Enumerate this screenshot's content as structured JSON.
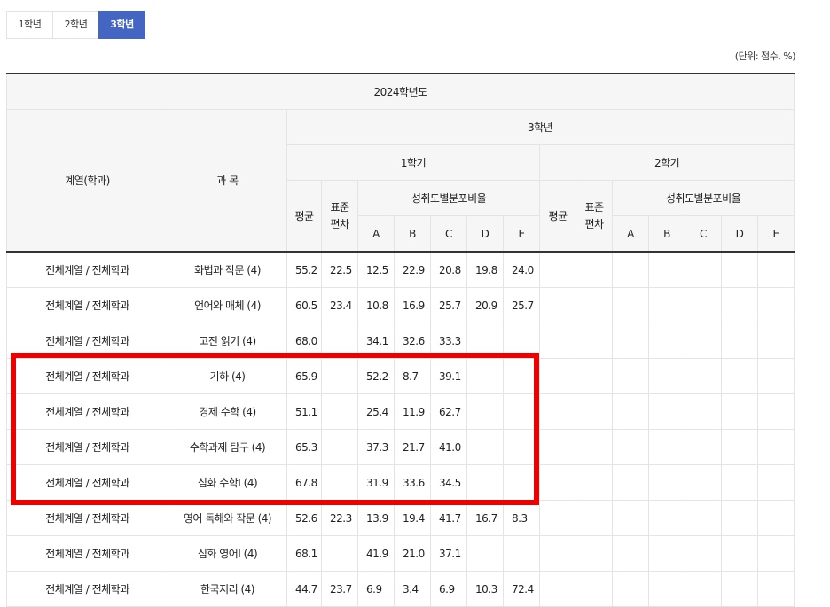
{
  "tabs": [
    "1학년",
    "2학년",
    "3학년"
  ],
  "active_tab": 2,
  "unit_note": "(단위: 점수, %)",
  "header": {
    "year": "2024학년도",
    "dept": "계열(학과)",
    "subject": "과 목",
    "grade": "3학년",
    "sem1": "1학기",
    "sem2": "2학기",
    "avg": "평균",
    "std": "표준\n편차",
    "dist": "성취도별분포비율",
    "grades": [
      "A",
      "B",
      "C",
      "D",
      "E"
    ]
  },
  "rows": [
    {
      "dept": "전체계열 / 전체학과",
      "subject": "화법과 작문 (4)",
      "avg": "55.2",
      "std": "22.5",
      "a": "12.5",
      "b": "22.9",
      "c": "20.8",
      "d": "19.8",
      "e": "24.0"
    },
    {
      "dept": "전체계열 / 전체학과",
      "subject": "언어와 매체 (4)",
      "avg": "60.5",
      "std": "23.4",
      "a": "10.8",
      "b": "16.9",
      "c": "25.7",
      "d": "20.9",
      "e": "25.7"
    },
    {
      "dept": "전체계열 / 전체학과",
      "subject": "고전 읽기 (4)",
      "avg": "68.0",
      "std": "",
      "a": "34.1",
      "b": "32.6",
      "c": "33.3",
      "d": "",
      "e": ""
    },
    {
      "dept": "전체계열 / 전체학과",
      "subject": "기하 (4)",
      "avg": "65.9",
      "std": "",
      "a": "52.2",
      "b": "8.7",
      "c": "39.1",
      "d": "",
      "e": ""
    },
    {
      "dept": "전체계열 / 전체학과",
      "subject": "경제 수학 (4)",
      "avg": "51.1",
      "std": "",
      "a": "25.4",
      "b": "11.9",
      "c": "62.7",
      "d": "",
      "e": ""
    },
    {
      "dept": "전체계열 / 전체학과",
      "subject": "수학과제 탐구 (4)",
      "avg": "65.3",
      "std": "",
      "a": "37.3",
      "b": "21.7",
      "c": "41.0",
      "d": "",
      "e": ""
    },
    {
      "dept": "전체계열 / 전체학과",
      "subject": "심화 수학Ⅰ (4)",
      "avg": "67.8",
      "std": "",
      "a": "31.9",
      "b": "33.6",
      "c": "34.5",
      "d": "",
      "e": ""
    },
    {
      "dept": "전체계열 / 전체학과",
      "subject": "영어 독해와 작문 (4)",
      "avg": "52.6",
      "std": "22.3",
      "a": "13.9",
      "b": "19.4",
      "c": "41.7",
      "d": "16.7",
      "e": "8.3"
    },
    {
      "dept": "전체계열 / 전체학과",
      "subject": "심화 영어Ⅰ (4)",
      "avg": "68.1",
      "std": "",
      "a": "41.9",
      "b": "21.0",
      "c": "37.1",
      "d": "",
      "e": ""
    },
    {
      "dept": "전체계열 / 전체학과",
      "subject": "한국지리 (4)",
      "avg": "44.7",
      "std": "23.7",
      "a": "6.9",
      "b": "3.4",
      "c": "6.9",
      "d": "10.3",
      "e": "72.4"
    }
  ]
}
